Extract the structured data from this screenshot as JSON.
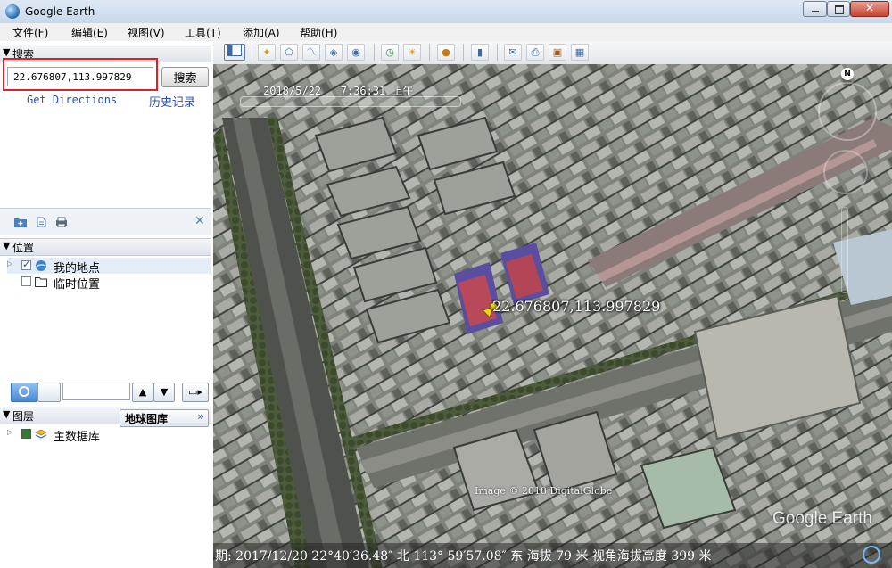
{
  "window": {
    "title": "Google Earth"
  },
  "menu": [
    {
      "label": "文件(F)"
    },
    {
      "label": "编辑(E)"
    },
    {
      "label": "视图(V)"
    },
    {
      "label": "工具(T)"
    },
    {
      "label": "添加(A)"
    },
    {
      "label": "帮助(H)"
    }
  ],
  "search": {
    "header": "搜索",
    "query": "22.676807,113.997829",
    "button": "搜索",
    "get_directions": "Get Directions",
    "history": "历史记录"
  },
  "places": {
    "header": "位置",
    "items": [
      {
        "label": "我的地点",
        "checked": true
      },
      {
        "label": "临时位置",
        "checked": false
      }
    ]
  },
  "layers": {
    "header": "图层",
    "gallery_button": "地球图库",
    "gallery_arrow": "»",
    "items": [
      {
        "label": "主数据库"
      }
    ]
  },
  "map": {
    "timestamp": "2018/5/22   7:36:31 上午",
    "marker_label": "22.676807,113.997829",
    "image_credit": "Image © 2018 DigitalGlobe",
    "brand": "Google Earth",
    "compass_letter": "N",
    "status_text": "期: 2017/12/20  22°40′36.48″ 北  113° 59′57.08″ 东 海拔     79 米  视角海拔高度     399 米"
  },
  "colors": {
    "highlight_box": "#d8232a",
    "link": "#2a4fb0",
    "marker_pin": "#f2d31b"
  }
}
